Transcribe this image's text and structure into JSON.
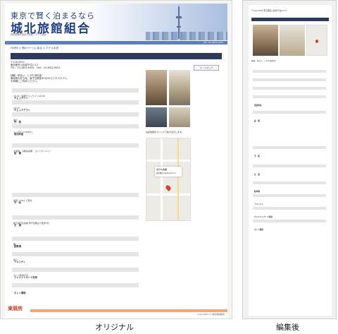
{
  "original": {
    "header": {
      "tagline": "東京で賢く泊まるなら",
      "title": "城北旅館組合",
      "subtitle": "東京都城北地区の旅館・ホテル組合"
    },
    "phone_bar": "TEL: 03-3892-9165",
    "breadcrumb": "HOME > 宿のページに戻る > ホテル丸忠",
    "hotel_name": "ホテル丸忠",
    "address": {
      "zip": "〒116-0003",
      "line1": "東京都荒川区南千住2-3-2",
      "tel": "TEL：03-3802-6444　FAX：03-3802-6053"
    },
    "map_button": "ルートマップ",
    "intro": [
      "静観、明るい、しかも低料金！",
      "東南角の好立地、南千住駅徒歩3分のビジネスホテル。",
      "お気軽にご利用ください。"
    ],
    "sections": [
      {
        "label": "チェックイン",
        "value": "15:00（最終チェックイン24:00）"
      },
      {
        "label": "チェックアウト",
        "value": "10:00"
      },
      {
        "label": "門　限",
        "value": "あり"
      },
      {
        "label": "宿泊料金",
        "value": "シングル 5,500円〜"
      },
      {
        "label": "設　備",
        "value": "大浴場、冷暖房完備、コインランドリー"
      },
      {
        "label": "予　約",
        "value": "電話・FAXにて受付"
      },
      {
        "label": "交　通",
        "value": "地下鉄日比谷線 南千住駅より徒歩3分"
      },
      {
        "label": "駐車場",
        "value": "無し"
      },
      {
        "label": "アメニティ",
        "value": "有り"
      },
      {
        "label": "クレジットカード利用",
        "value": "カード利用不可"
      },
      {
        "label": "ネット環境",
        "value": "無線LAN"
      }
    ],
    "map_note": "左記地図をクリックで拡大表示します。",
    "map_card": {
      "name": "ホテル丸忠",
      "address": "東京都荒川区南千住2-3-2"
    },
    "footer": {
      "logo": "東競房",
      "copy": "Copyright (c) 城北旅館組合"
    }
  },
  "edited": {
    "hotel_name": "ホテル丸忠",
    "address": "〒116-0003 東京都荒川区南千住2-3-2",
    "intro": "静観、明るい、しかも低料金！",
    "sections": [
      "チェックイン",
      "チェックアウト",
      "門　限",
      "宿泊料金",
      "設　備",
      "予　約",
      "交　通",
      "駐車場",
      "アメニティ",
      "クレジットカード利用",
      "ネット環境"
    ]
  },
  "captions": {
    "left": "オリジナル",
    "right": "編集後"
  },
  "colors": {
    "brand": "#1d3f87",
    "bar": "#5b7fc0",
    "dark": "#2d3a5c",
    "section": "#e5e5e5",
    "footer": "#f0a878"
  }
}
